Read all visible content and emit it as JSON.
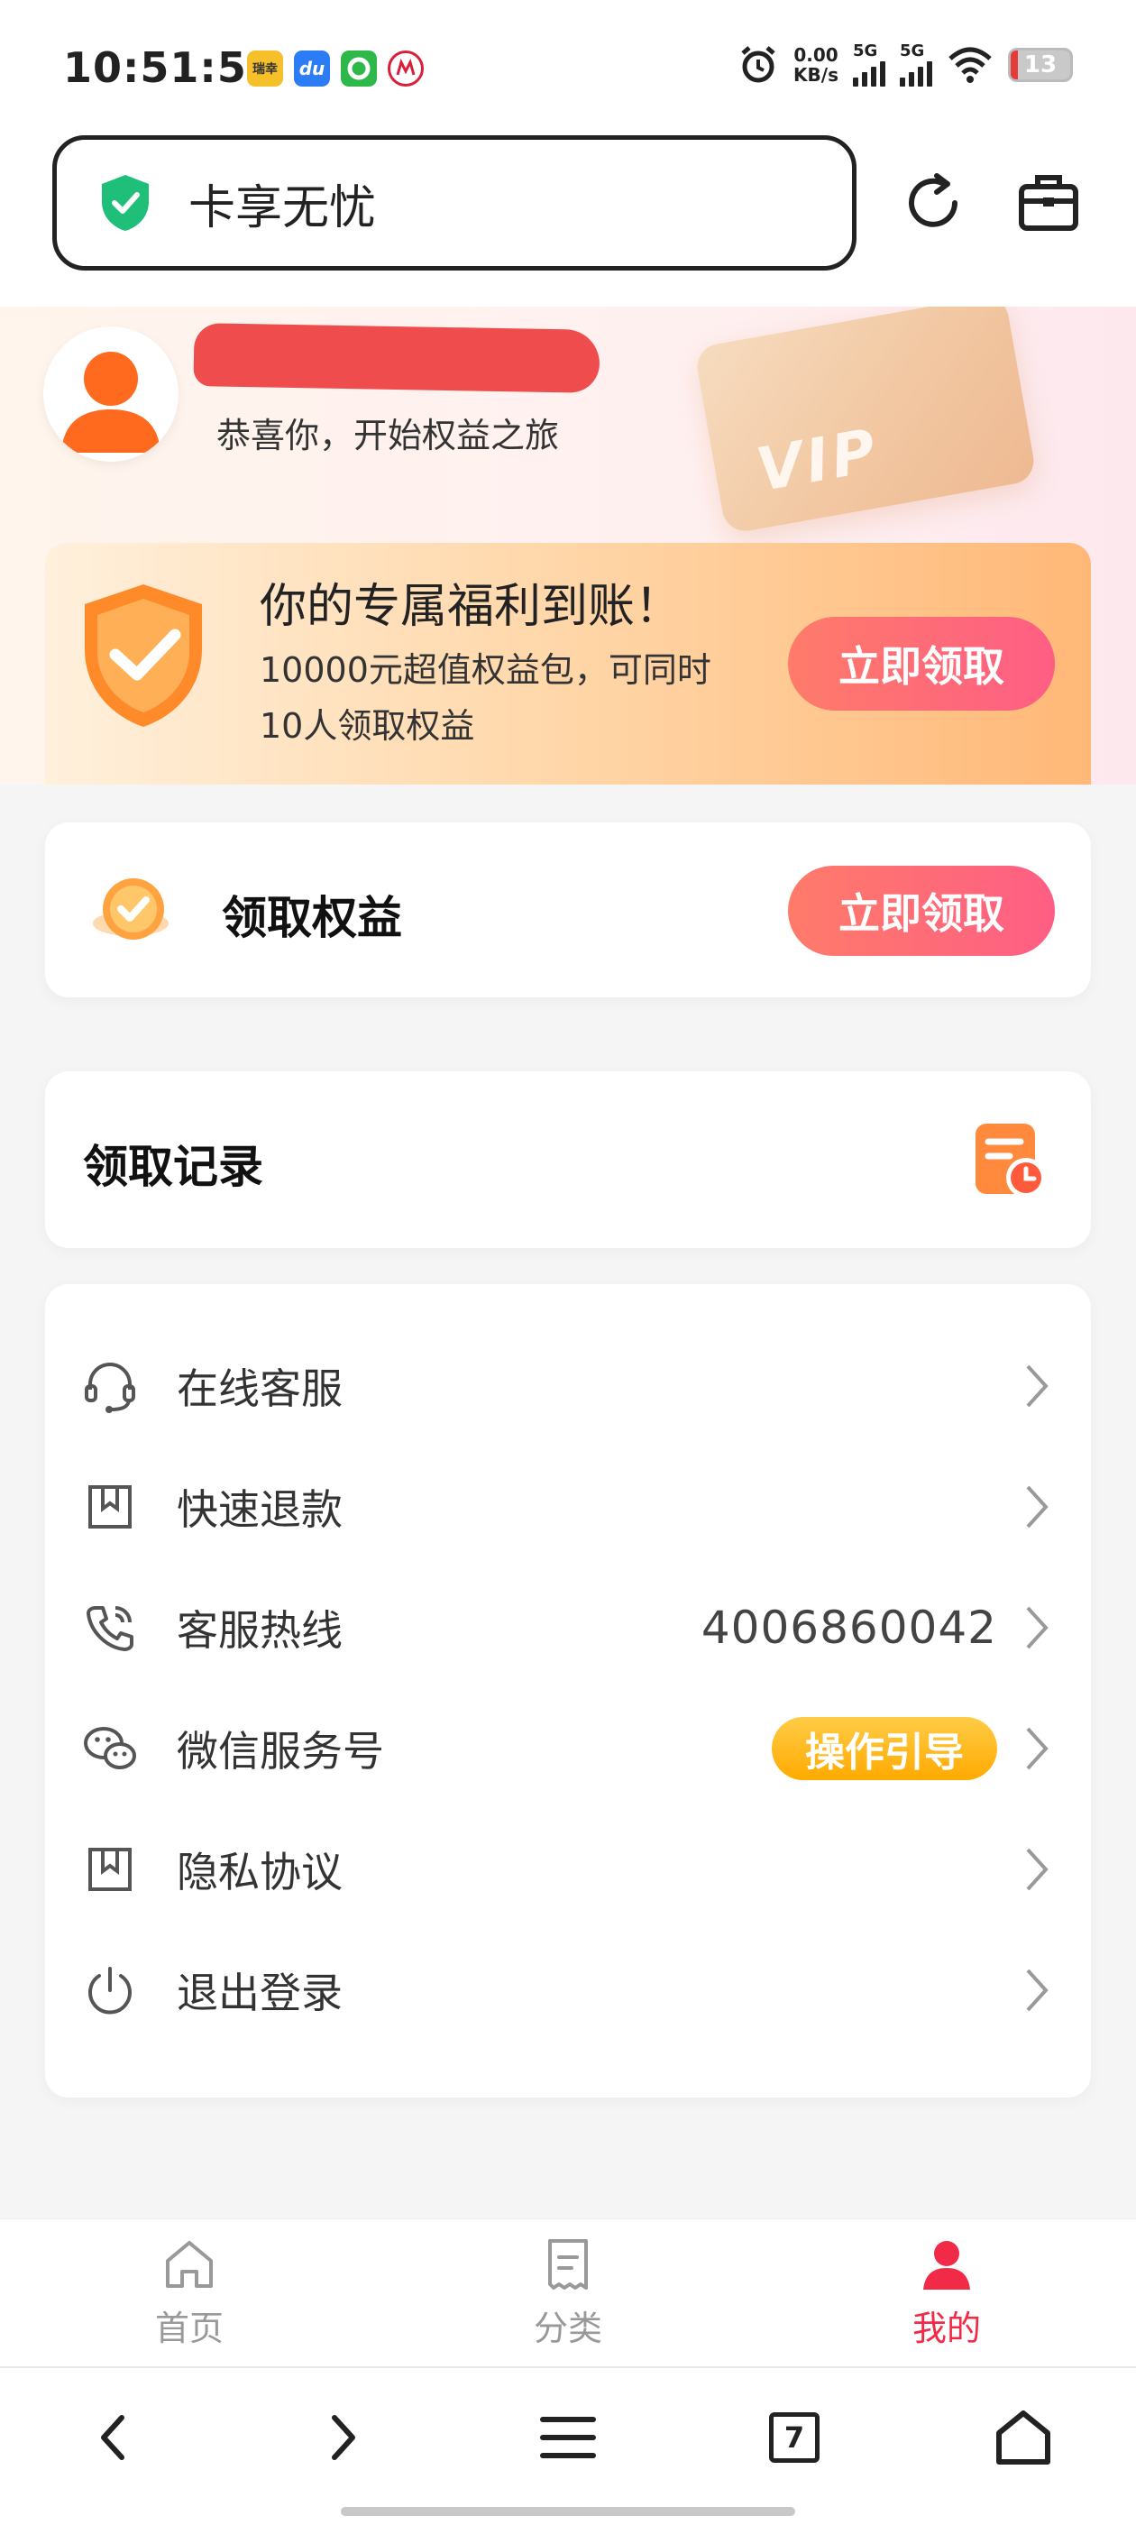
{
  "status_bar": {
    "time": "10:51:56",
    "net_speed_value": "0.00",
    "net_speed_unit": "KB/s",
    "sim1": "5G",
    "sim2": "5G",
    "battery": "13",
    "apps": [
      {
        "label": "瑞幸",
        "color": "#f6c02b"
      },
      {
        "label": "du",
        "color": "#2c7cf6"
      },
      {
        "label": "",
        "color": "#2fb84a"
      },
      {
        "label": "",
        "color": "#d8203a"
      }
    ]
  },
  "browser": {
    "page_title": "卡享无忧",
    "tab_count": "7"
  },
  "hero": {
    "subtitle": "恭喜你，开始权益之旅",
    "vip_label": "VIP",
    "banner_title": "你的专属福利到账！",
    "banner_desc": "10000元超值权益包，可同时10人领取权益",
    "banner_button": "立即领取"
  },
  "claim_card": {
    "title": "领取权益",
    "button": "立即领取"
  },
  "records_card": {
    "title": "领取记录"
  },
  "menu": {
    "items": [
      {
        "label": "在线客服",
        "icon": "headset-icon"
      },
      {
        "label": "快速退款",
        "icon": "bookmark-icon"
      },
      {
        "label": "客服热线",
        "icon": "phone-icon",
        "value": "4006860042"
      },
      {
        "label": "微信服务号",
        "icon": "wechat-icon",
        "badge": "操作引导"
      },
      {
        "label": "隐私协议",
        "icon": "bookmark-icon"
      },
      {
        "label": "退出登录",
        "icon": "power-icon"
      }
    ]
  },
  "bottom_nav": {
    "items": [
      {
        "label": "首页",
        "icon": "home-icon",
        "active": false
      },
      {
        "label": "分类",
        "icon": "category-icon",
        "active": false
      },
      {
        "label": "我的",
        "icon": "profile-icon",
        "active": true
      }
    ],
    "active_color": "#f12b47"
  }
}
